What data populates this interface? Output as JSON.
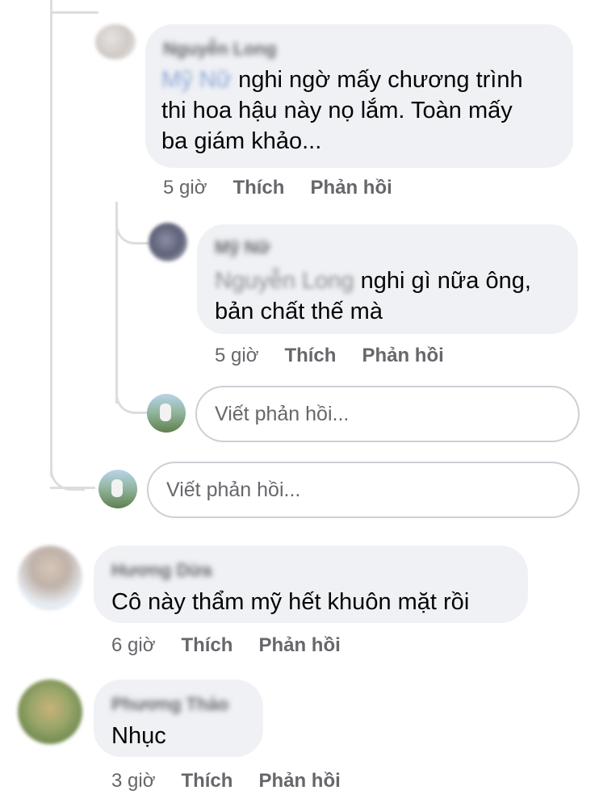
{
  "comments": [
    {
      "name": "Nguyễn Long",
      "mention": "Mỹ Nữ",
      "text_line1": "nghi ngờ mấy chương trình",
      "text_line2": "thi hoa hậu này nọ lắm. Toàn mấy",
      "text_line3": "ba giám khảo...",
      "time": "5 giờ",
      "like": "Thích",
      "reply": "Phản hồi"
    },
    {
      "name": "Mỹ Nữ",
      "mention": "Nguyễn Long",
      "text_line1": "nghi gì nữa ông,",
      "text_line2": "bản chất thế mà",
      "time": "5 giờ",
      "like": "Thích",
      "reply": "Phản hồi"
    },
    {
      "name": "Hương Dừa",
      "text_line1": "Cô này thẩm mỹ hết khuôn mặt rồi",
      "time": "6 giờ",
      "like": "Thích",
      "reply": "Phản hồi"
    },
    {
      "name": "Phương Thảo",
      "text_line1": "Nhục",
      "time": "3 giờ",
      "like": "Thích",
      "reply": "Phản hồi"
    }
  ],
  "reply_inputs": [
    {
      "placeholder": "Viết phản hồi..."
    },
    {
      "placeholder": "Viết phản hồi..."
    }
  ]
}
